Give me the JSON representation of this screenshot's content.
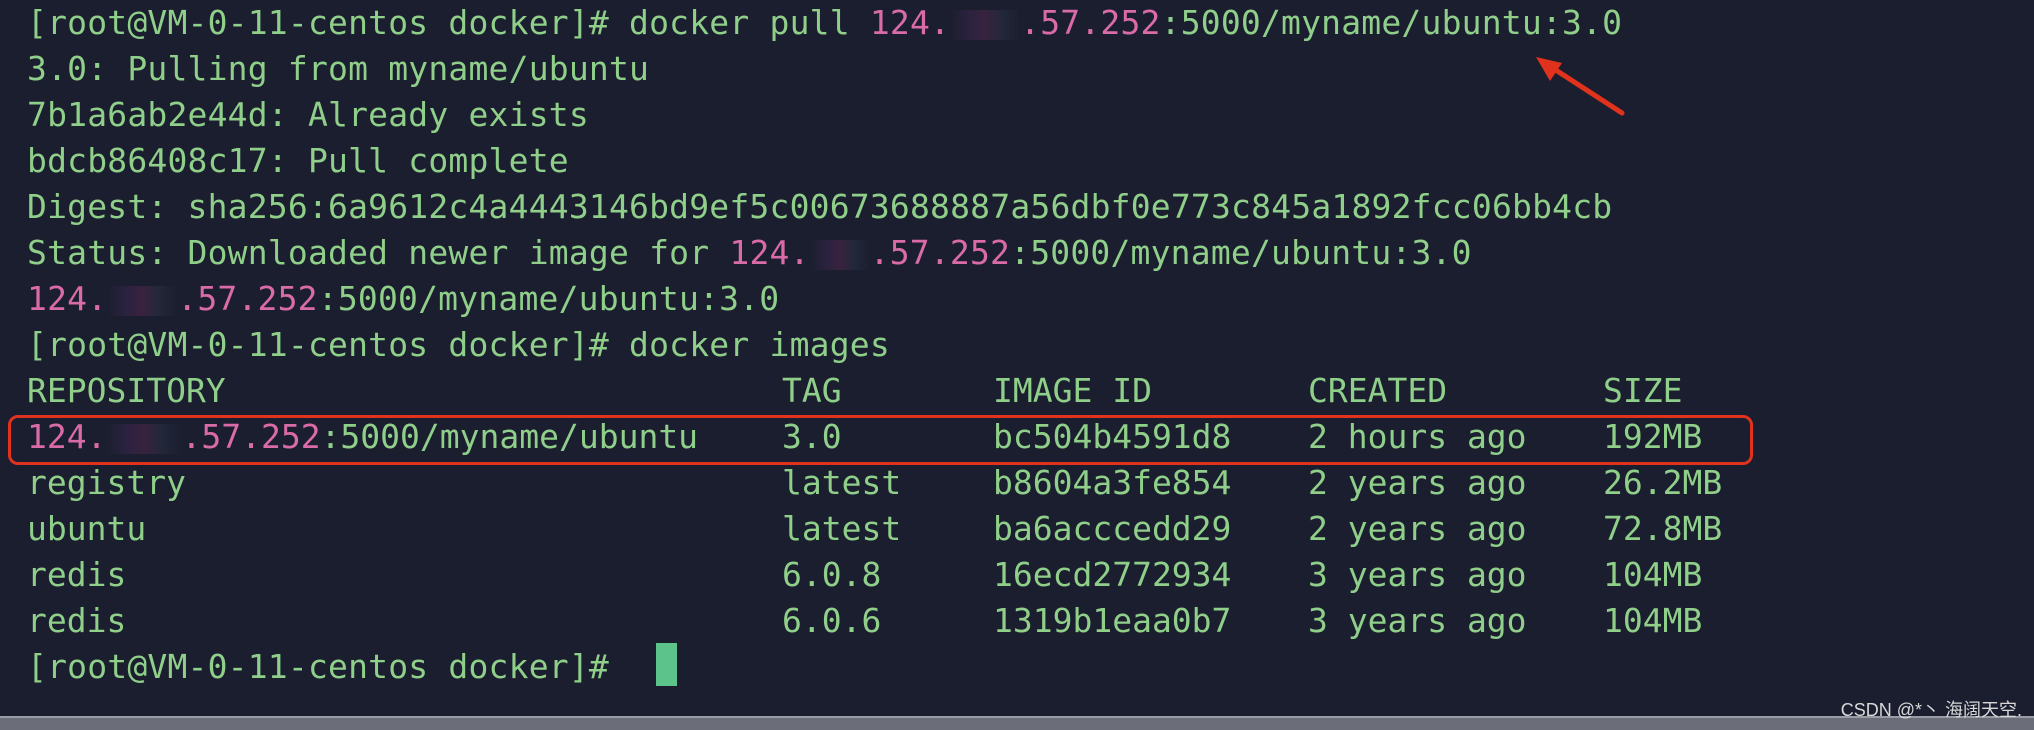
{
  "terminal": {
    "prompt": "[root@VM-0-11-centos docker]#",
    "line1": {
      "cmd": " docker pull ",
      "ip_a": "124.",
      "ip_b": ".57.252",
      "rest": ":5000/myname/ubuntu:3.0"
    },
    "line2": "3.0: Pulling from myname/ubuntu",
    "line3": "7b1a6ab2e44d: Already exists",
    "line4": "bdcb86408c17: Pull complete",
    "line5": "Digest: sha256:6a9612c4a4443146bd9ef5c00673688887a56dbf0e773c845a1892fcc06bb4cb",
    "line6": {
      "text": "Status: Downloaded newer image for ",
      "ip_a": "124.",
      "ip_b": ".57.252",
      "rest": ":5000/myname/ubuntu:3.0"
    },
    "line7": {
      "ip_a": "124.",
      "ip_b": ".57.252",
      "rest": ":5000/myname/ubuntu:3.0"
    },
    "line8_cmd": " docker images",
    "headers": {
      "repository": "REPOSITORY",
      "tag": "TAG",
      "image_id": "IMAGE ID",
      "created": "CREATED",
      "size": "SIZE"
    },
    "rows": [
      {
        "repo_ip_a": "124.",
        "repo_ip_b": ".57.252",
        "repo_rest": ":5000/myname/ubuntu",
        "tag": "3.0",
        "image_id": "bc504b4591d8",
        "created": "2 hours ago",
        "size": "192MB"
      },
      {
        "repo": "registry",
        "tag": "latest",
        "image_id": "b8604a3fe854",
        "created": "2 years ago",
        "size": "26.2MB"
      },
      {
        "repo": "ubuntu",
        "tag": "latest",
        "image_id": "ba6acccedd29",
        "created": "2 years ago",
        "size": "72.8MB"
      },
      {
        "repo": "redis",
        "tag": "6.0.8",
        "image_id": "16ecd2772934",
        "created": "3 years ago",
        "size": "104MB"
      },
      {
        "repo": "redis",
        "tag": "6.0.6",
        "image_id": "1319b1eaa0b7",
        "created": "3 years ago",
        "size": "104MB"
      }
    ]
  },
  "watermark": "CSDN @*丶 海阔天空.",
  "colors": {
    "background": "#1b1e2e",
    "text": "#8fcf8a",
    "ip": "#d96ba8",
    "highlight": "#e0321c",
    "cursor": "#5cc48b"
  }
}
